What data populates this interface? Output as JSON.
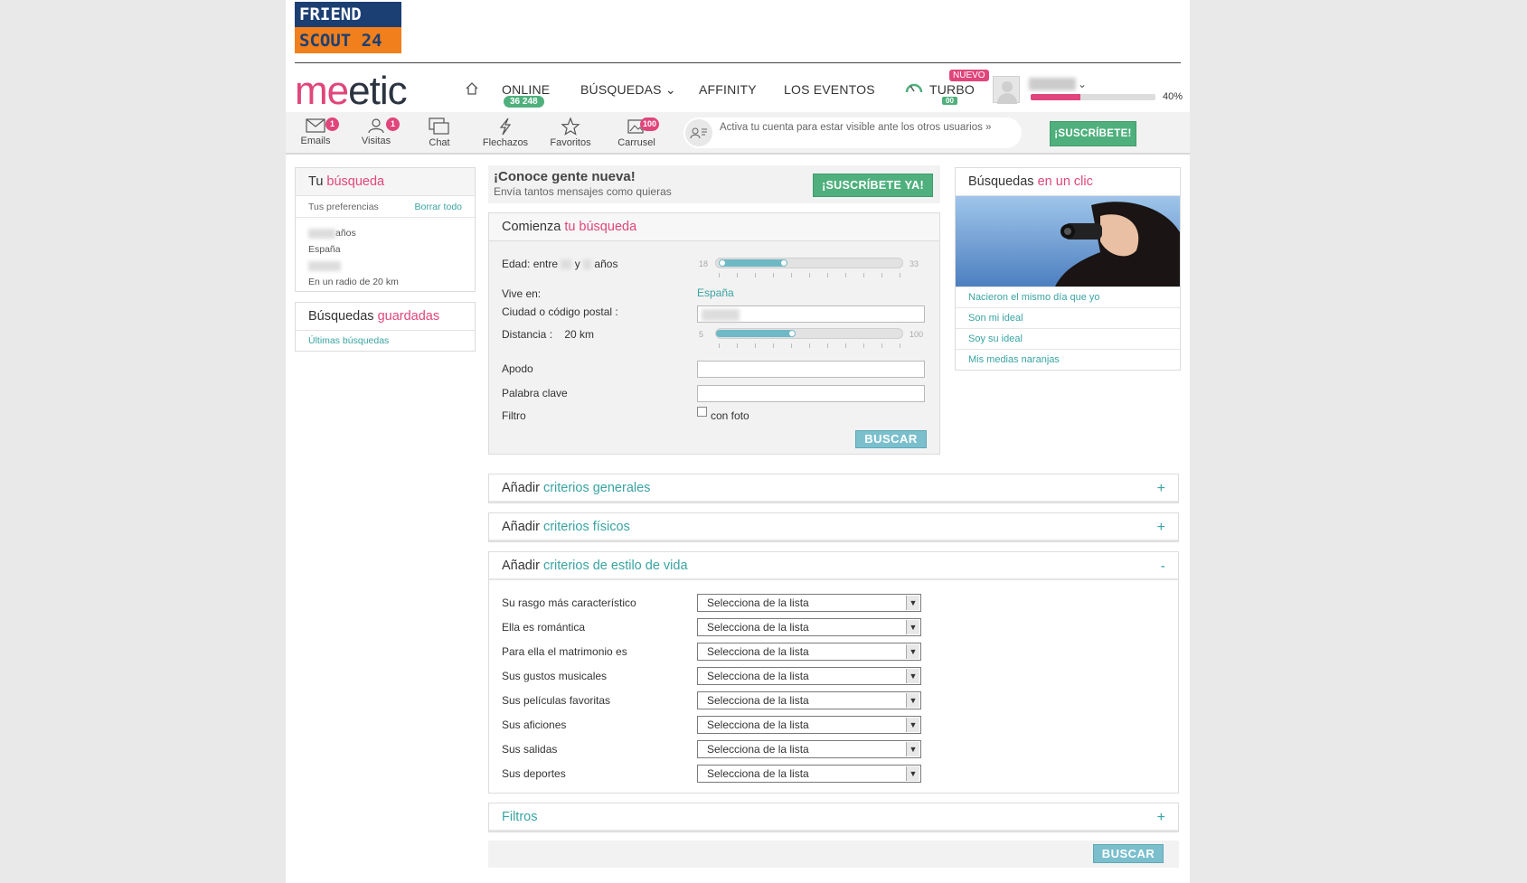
{
  "brand": {
    "friendscout_line1": "FRIEND",
    "friendscout_line2": "SCOUT 24",
    "logo_me": "me",
    "logo_rest": "etic"
  },
  "nav": {
    "online_label": "ONLINE",
    "online_count": "36 248",
    "busquedas": "BÚSQUEDAS",
    "affinity": "AFFINITY",
    "eventos": "LOS EVENTOS",
    "turbo": "TURBO",
    "turbo_badge": "NUEVO",
    "turbo_sub": "00",
    "profile_progress": 0.4,
    "profile_progress_label": "40%"
  },
  "toolbar": {
    "items": [
      {
        "label": "Emails",
        "icon": "envelope-icon",
        "badge": "1"
      },
      {
        "label": "Visitas",
        "icon": "person-icon",
        "badge": "1"
      },
      {
        "label": "Chat",
        "icon": "chat-icon",
        "badge": ""
      },
      {
        "label": "Flechazos",
        "icon": "lightning-icon",
        "badge": ""
      },
      {
        "label": "Favoritos",
        "icon": "star-icon",
        "badge": ""
      },
      {
        "label": "Carrusel",
        "icon": "carousel-icon",
        "badge": "100"
      }
    ],
    "activate_text": "Activa tu cuenta para estar visible ante los otros usuarios »",
    "subscribe": "¡SUSCRÍBETE!"
  },
  "left": {
    "tu_busqueda": {
      "prefix": "Tu ",
      "highlight": "búsqueda"
    },
    "prefs_label": "Tus preferencias",
    "clear_all": "Borrar todo",
    "pref_age_suffix": "años",
    "pref_country": "España",
    "pref_radius": "En un radio de 20 km",
    "guardadas": {
      "prefix": "Búsquedas ",
      "highlight": "guardadas"
    },
    "ultimas": "Últimas búsquedas"
  },
  "promo": {
    "title": "¡Conoce gente nueva!",
    "subtitle": "Envía tantos mensajes como quieras",
    "button": "¡SUSCRÍBETE YA!"
  },
  "search": {
    "head_prefix": "Comienza ",
    "head_highlight": "tu búsqueda",
    "edad_label": "Edad: entre",
    "edad_y": "y",
    "edad_suffix": "años",
    "edad_min": "18",
    "edad_max": "33",
    "vive_label": "Vive en:",
    "vive_value": "España",
    "ciudad_label": "Ciudad o código postal :",
    "distancia_label": "Distancia :",
    "distancia_value": "20  km",
    "dist_min": "5",
    "dist_max": "100",
    "apodo_label": "Apodo",
    "palabra_label": "Palabra clave",
    "filtro_label": "Filtro",
    "con_foto": "con foto",
    "buscar": "BUSCAR"
  },
  "accordions": {
    "generales": {
      "prefix": "Añadir ",
      "highlight": "criterios generales",
      "toggle": "+"
    },
    "fisicos": {
      "prefix": "Añadir ",
      "highlight": "criterios físicos",
      "toggle": "+"
    },
    "estilo": {
      "prefix": "Añadir ",
      "highlight": "criterios de estilo de vida",
      "toggle": "-"
    },
    "filtros": {
      "label": "Filtros",
      "toggle": "+"
    }
  },
  "estilo_rows": [
    {
      "label": "Su rasgo más característico",
      "value": "Selecciona de la lista"
    },
    {
      "label": "Ella es romántica",
      "value": "Selecciona de la lista"
    },
    {
      "label": "Para ella el matrimonio es",
      "value": "Selecciona de la lista"
    },
    {
      "label": "Sus gustos musicales",
      "value": "Selecciona de la lista"
    },
    {
      "label": "Sus películas favoritas",
      "value": "Selecciona de la lista"
    },
    {
      "label": "Sus aficiones",
      "value": "Selecciona de la lista"
    },
    {
      "label": "Sus salidas",
      "value": "Selecciona de la lista"
    },
    {
      "label": "Sus deportes",
      "value": "Selecciona de la lista"
    }
  ],
  "bottom_buscar": "BUSCAR",
  "right": {
    "title_prefix": "Búsquedas ",
    "title_highlight": "en un clic",
    "links": [
      "Nacieron el mismo día que yo",
      "Son mi ideal",
      "Soy su ideal",
      "Mis medias naranjas"
    ]
  },
  "colors": {
    "pink": "#e0457b",
    "teal": "#3aa3a3",
    "green": "#4fb07d",
    "blue_button": "#7bbfcd"
  }
}
